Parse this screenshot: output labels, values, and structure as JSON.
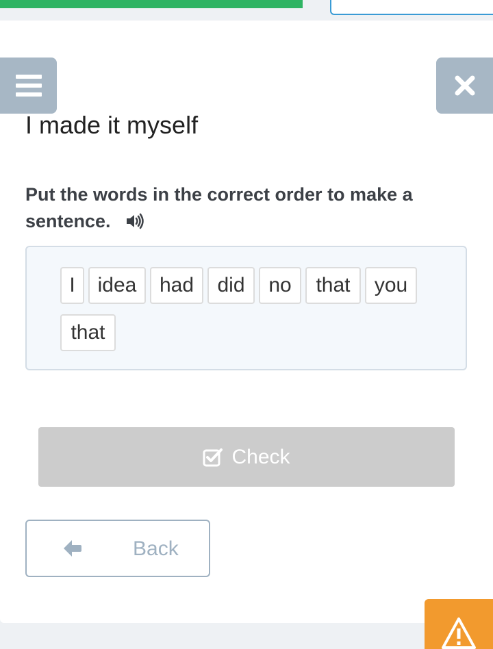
{
  "progress": {
    "fraction": 0.61,
    "color": "#2fb463"
  },
  "header": {
    "menu_icon": "hamburger-icon",
    "close_icon": "close-icon"
  },
  "page": {
    "title": "I made it myself",
    "instruction": "Put the words in the correct order to make a sentence.",
    "audio_icon": "speaker-icon"
  },
  "words": [
    "I",
    "idea",
    "had",
    "did",
    "no",
    "that",
    "you",
    "that"
  ],
  "actions": {
    "check_label": "Check",
    "check_icon": "checkbox-icon",
    "back_label": "Back",
    "back_icon": "arrow-left-icon",
    "report_icon": "warning-icon"
  },
  "colors": {
    "accent_green": "#2fb463",
    "button_grey": "#a7b7c5",
    "check_disabled": "#cccccc",
    "warning_orange": "#f29a2e",
    "field_border": "#3a9bd5"
  }
}
